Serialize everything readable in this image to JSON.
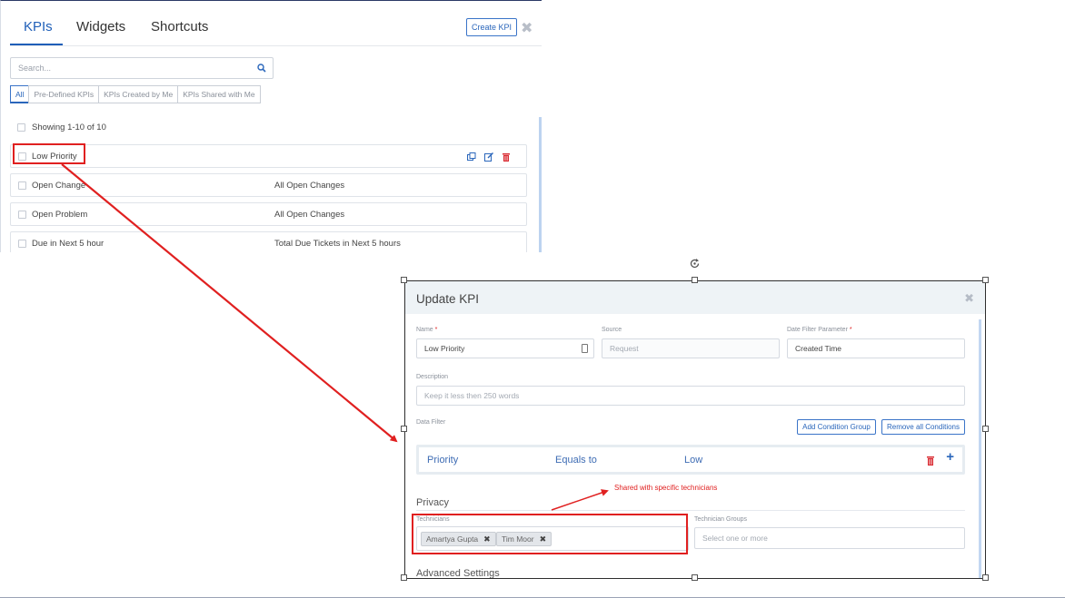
{
  "left_panel": {
    "tabs": [
      {
        "label": "KPIs",
        "active": true
      },
      {
        "label": "Widgets",
        "active": false
      },
      {
        "label": "Shortcuts",
        "active": false
      }
    ],
    "create_button": "Create KPI",
    "close_icon": "close-icon",
    "search": {
      "placeholder": "Search...",
      "icon": "search-icon"
    },
    "filters": [
      {
        "label": "All",
        "active": true
      },
      {
        "label": "Pre-Defined KPIs",
        "active": false
      },
      {
        "label": "KPIs Created by Me",
        "active": false
      },
      {
        "label": "KPIs Shared with Me",
        "active": false
      }
    ],
    "showing_text": "Showing 1-10 of 10",
    "kpi_rows": [
      {
        "name": "Low Priority",
        "description": "",
        "actions": [
          "copy-icon",
          "edit-icon",
          "delete-icon"
        ]
      },
      {
        "name": "Open Change",
        "description": "All Open Changes"
      },
      {
        "name": "Open Problem",
        "description": "All Open Changes"
      },
      {
        "name": "Due in Next 5 hour",
        "description": "Total Due Tickets in Next 5 hours"
      }
    ]
  },
  "modal": {
    "title": "Update KPI",
    "fields": {
      "name": {
        "label": "Name",
        "value": "Low Priority",
        "required": true
      },
      "source": {
        "label": "Source",
        "placeholder": "Request"
      },
      "date_filter": {
        "label": "Date Filter Parameter",
        "value": "Created Time",
        "required": true
      },
      "description": {
        "label": "Description",
        "placeholder": "Keep it less then 250 words"
      },
      "data_filter": {
        "label": "Data Filter"
      }
    },
    "buttons": {
      "add_condition_group": "Add Condition Group",
      "remove_all_conditions": "Remove all Conditions"
    },
    "condition": {
      "field": "Priority",
      "operator": "Equals to",
      "value": "Low"
    },
    "privacy": {
      "title": "Privacy",
      "technicians_label": "Technicians",
      "technicians": [
        "Amartya Gupta",
        "Tim Moor"
      ],
      "technician_groups_label": "Technician Groups",
      "technician_groups_placeholder": "Select one or more"
    },
    "advanced_settings": "Advanced Settings"
  },
  "annotation": {
    "text": "Shared with specific technicians",
    "color": "#e02020"
  },
  "colors": {
    "accent": "#1f5fb8",
    "annotation_red": "#e02020",
    "delete_red": "#d9282f"
  }
}
